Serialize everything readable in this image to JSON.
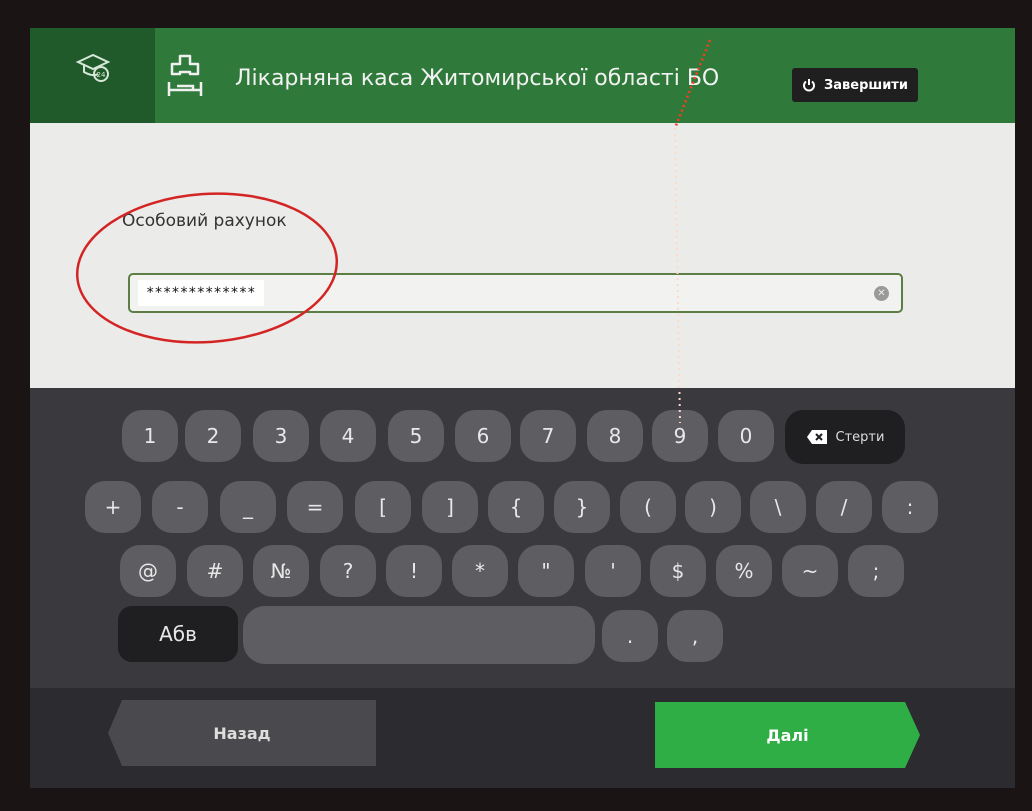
{
  "header": {
    "title": "Лікарняна каса Житомирської області БО",
    "finish_label": "Завершити",
    "logo_badge": "24"
  },
  "form": {
    "field_label": "Особовий рахунок",
    "field_value": "*************"
  },
  "keyboard": {
    "row1": [
      "1",
      "2",
      "3",
      "4",
      "5",
      "6",
      "7",
      "8",
      "9",
      "0"
    ],
    "erase_label": "Стерти",
    "row2": [
      "+",
      "-",
      "_",
      "=",
      "[",
      "]",
      "{",
      "}",
      "(",
      ")",
      "\\",
      "/",
      ":"
    ],
    "row3": [
      "@",
      "#",
      "№",
      "?",
      "!",
      "*",
      "\"",
      "'",
      "$",
      "%",
      "~",
      ";"
    ],
    "layout_switch_label": "Абв",
    "row4_extra": [
      ".",
      ","
    ]
  },
  "footer": {
    "back_label": "Назад",
    "next_label": "Далі"
  },
  "colors": {
    "header_green": "#2f7a3a",
    "accent_green": "#2fae45",
    "input_border": "#5d7d44"
  }
}
